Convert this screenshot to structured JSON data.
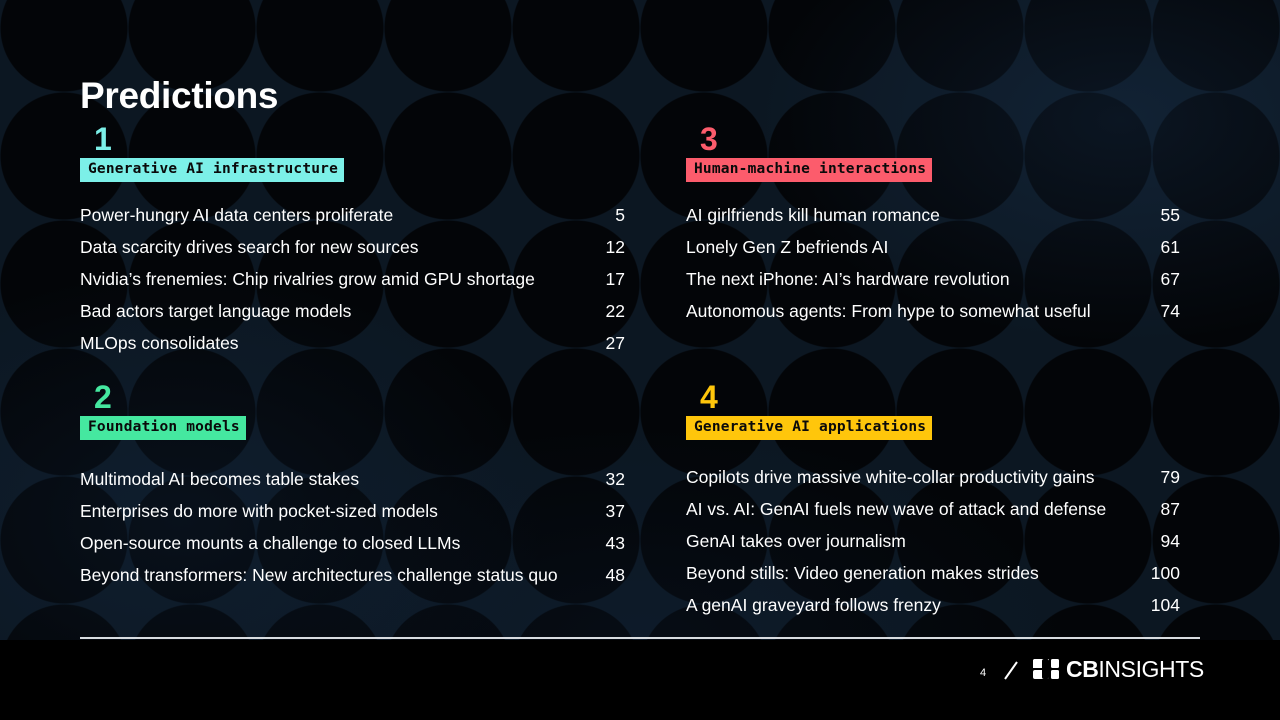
{
  "slide": {
    "title": "Predictions",
    "background": {
      "base_color": "#0c1722",
      "circle_color": "#030508",
      "footer_color": "#000000"
    }
  },
  "sections": [
    {
      "number": "1",
      "label": "Generative AI infrastructure",
      "accent": "#7cf0e8",
      "items": [
        {
          "title": "Power-hungry AI data centers proliferate",
          "page": "5"
        },
        {
          "title": "Data scarcity drives search for new sources",
          "page": "12"
        },
        {
          "title": "Nvidia’s frenemies: Chip rivalries grow amid GPU shortage",
          "page": "17"
        },
        {
          "title": "Bad actors target language models",
          "page": "22"
        },
        {
          "title": "MLOps consolidates",
          "page": "27"
        }
      ]
    },
    {
      "number": "2",
      "label": "Foundation models",
      "accent": "#45e8a0",
      "items": [
        {
          "title": "Multimodal AI becomes table stakes",
          "page": "32"
        },
        {
          "title": "Enterprises do more with pocket-sized models",
          "page": "37"
        },
        {
          "title": "Open-source mounts a challenge to closed LLMs",
          "page": "43"
        },
        {
          "title": "Beyond transformers: New architectures challenge status quo",
          "page": "48"
        }
      ]
    },
    {
      "number": "3",
      "label": "Human-machine interactions",
      "accent": "#fc5c6c",
      "items": [
        {
          "title": "AI girlfriends kill human romance",
          "page": "55"
        },
        {
          "title": "Lonely Gen Z befriends AI",
          "page": "61"
        },
        {
          "title": "The next iPhone: AI’s hardware revolution",
          "page": "67"
        },
        {
          "title": "Autonomous agents: From hype to somewhat useful",
          "page": "74"
        }
      ]
    },
    {
      "number": "4",
      "label": "Generative AI applications",
      "accent": "#ffc60b",
      "items": [
        {
          "title": "Copilots drive massive white-collar productivity gains",
          "page": "79"
        },
        {
          "title": "AI vs. AI: GenAI fuels new wave of attack and defense",
          "page": "87"
        },
        {
          "title": "GenAI takes over journalism",
          "page": "94"
        },
        {
          "title": "Beyond stills: Video generation makes strides",
          "page": "100"
        },
        {
          "title": "A genAI graveyard follows frenzy",
          "page": "104"
        }
      ]
    }
  ],
  "footer": {
    "page_number": "4",
    "separator": "/",
    "brand_cb": "CB",
    "brand_insights": "INSIGHTS",
    "rule_color": "#d8dce0"
  }
}
